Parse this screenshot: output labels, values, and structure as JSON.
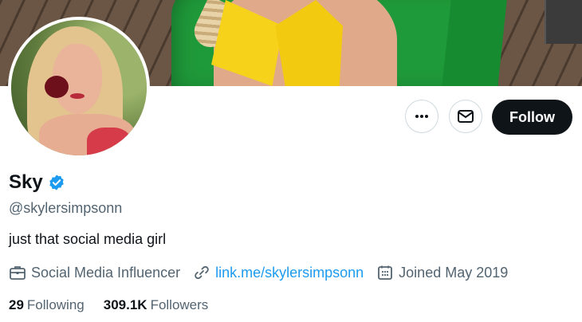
{
  "profile": {
    "name": "Sky",
    "handle": "@skylersimpsonn",
    "bio": "just that social media girl",
    "category": "Social Media Influencer",
    "link": "link.me/skylersimpsonn",
    "joined": "Joined May 2019",
    "verified": true
  },
  "stats": {
    "following_count": "29",
    "following_label": "Following",
    "followers_count": "309.1K",
    "followers_label": "Followers"
  },
  "actions": {
    "follow_label": "Follow",
    "more_icon": "more-icon",
    "message_icon": "mail-icon"
  },
  "colors": {
    "accent": "#1d9bf0",
    "follow_bg": "#0f1419",
    "secondary_text": "#536471"
  }
}
